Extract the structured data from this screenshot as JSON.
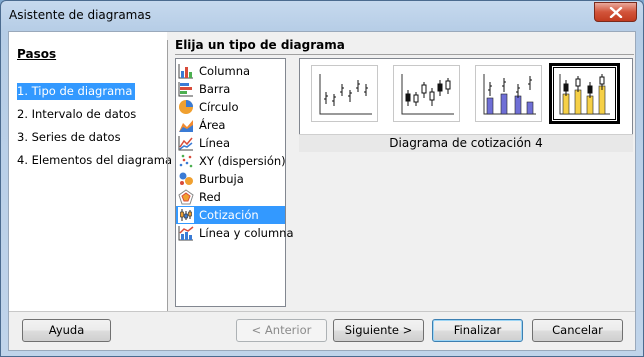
{
  "window": {
    "title": "Asistente de diagramas"
  },
  "steps": {
    "title": "Pasos",
    "items": [
      {
        "label": "1. Tipo de diagrama",
        "active": true
      },
      {
        "label": "2. Intervalo de datos",
        "active": false
      },
      {
        "label": "3. Series de datos",
        "active": false
      },
      {
        "label": "4. Elementos del diagrama",
        "active": false
      }
    ]
  },
  "main": {
    "heading": "Elija un tipo de diagrama",
    "chart_types": [
      {
        "label": "Columna",
        "icon": "column-chart-icon"
      },
      {
        "label": "Barra",
        "icon": "bar-chart-icon"
      },
      {
        "label": "Círculo",
        "icon": "pie-chart-icon"
      },
      {
        "label": "Área",
        "icon": "area-chart-icon"
      },
      {
        "label": "Línea",
        "icon": "line-chart-icon"
      },
      {
        "label": "XY (dispersión)",
        "icon": "scatter-chart-icon"
      },
      {
        "label": "Burbuja",
        "icon": "bubble-chart-icon"
      },
      {
        "label": "Red",
        "icon": "net-chart-icon"
      },
      {
        "label": "Cotización",
        "icon": "stock-chart-icon",
        "selected": true
      },
      {
        "label": "Línea y columna",
        "icon": "column-line-chart-icon"
      }
    ],
    "variant_caption": "Diagrama de cotización 4",
    "selected_variant": 4
  },
  "buttons": {
    "help": "Ayuda",
    "back": "< Anterior",
    "next": "Siguiente >",
    "finish": "Finalizar",
    "cancel": "Cancelar"
  },
  "colors": {
    "selection": "#3399ff",
    "bar_blue": "#6f6fd6",
    "bar_yellow": "#f6d046"
  }
}
